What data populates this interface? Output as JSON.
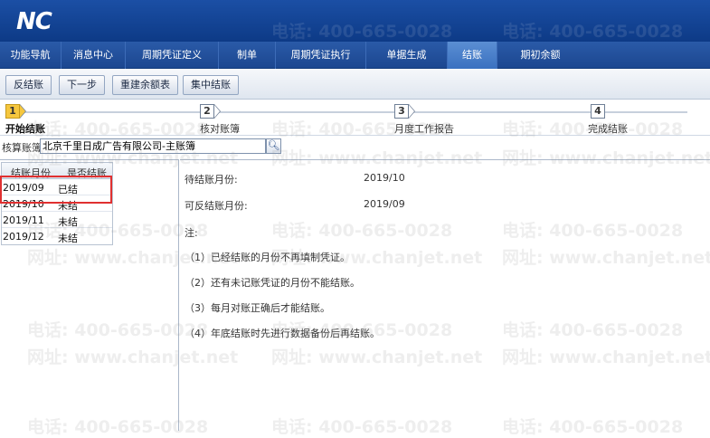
{
  "app": {
    "logo": "NC"
  },
  "nav": {
    "items": [
      {
        "label": "功能导航"
      },
      {
        "label": "消息中心"
      },
      {
        "label": "周期凭证定义"
      },
      {
        "label": "制单"
      },
      {
        "label": "周期凭证执行"
      },
      {
        "label": "单据生成"
      },
      {
        "label": "结账"
      },
      {
        "label": "期初余额"
      }
    ],
    "active_index": 6
  },
  "toolbar": {
    "unclose": "反结账",
    "next": "下一步",
    "rebuild": "重建余额表",
    "batch": "集中结账"
  },
  "steps": [
    {
      "num": "1",
      "label": "开始结账"
    },
    {
      "num": "2",
      "label": "核对账簿"
    },
    {
      "num": "3",
      "label": "月度工作报告"
    },
    {
      "num": "4",
      "label": "完成结账"
    }
  ],
  "account": {
    "label": "核算账簿",
    "value": "北京千里日成广告有限公司-主账簿"
  },
  "grid": {
    "headers": [
      "结账月份",
      "是否结账"
    ],
    "rows": [
      {
        "month": "2019/09",
        "status": "已结"
      },
      {
        "month": "2019/10",
        "status": "未结"
      },
      {
        "month": "2019/11",
        "status": "未结"
      },
      {
        "month": "2019/12",
        "status": "未结"
      }
    ]
  },
  "info": {
    "pending_label": "待结账月份:",
    "pending_value": "2019/10",
    "reversible_label": "可反结账月份:",
    "reversible_value": "2019/09",
    "note_label": "注:",
    "notes": [
      "（1）已经结账的月份不再填制凭证。",
      "（2）还有未记账凭证的月份不能结账。",
      "（3）每月对账正确后才能结账。",
      "（4）年底结账时先进行数据备份后再结账。"
    ]
  },
  "watermark": {
    "phone": "电话: 400-665-0028",
    "site": "网址: www.chanjet.net"
  },
  "colors": {
    "header": "#1b4fa5",
    "active_tab": "#4a80c9",
    "highlight": "#e03030",
    "step_active": "#f6c73e"
  }
}
